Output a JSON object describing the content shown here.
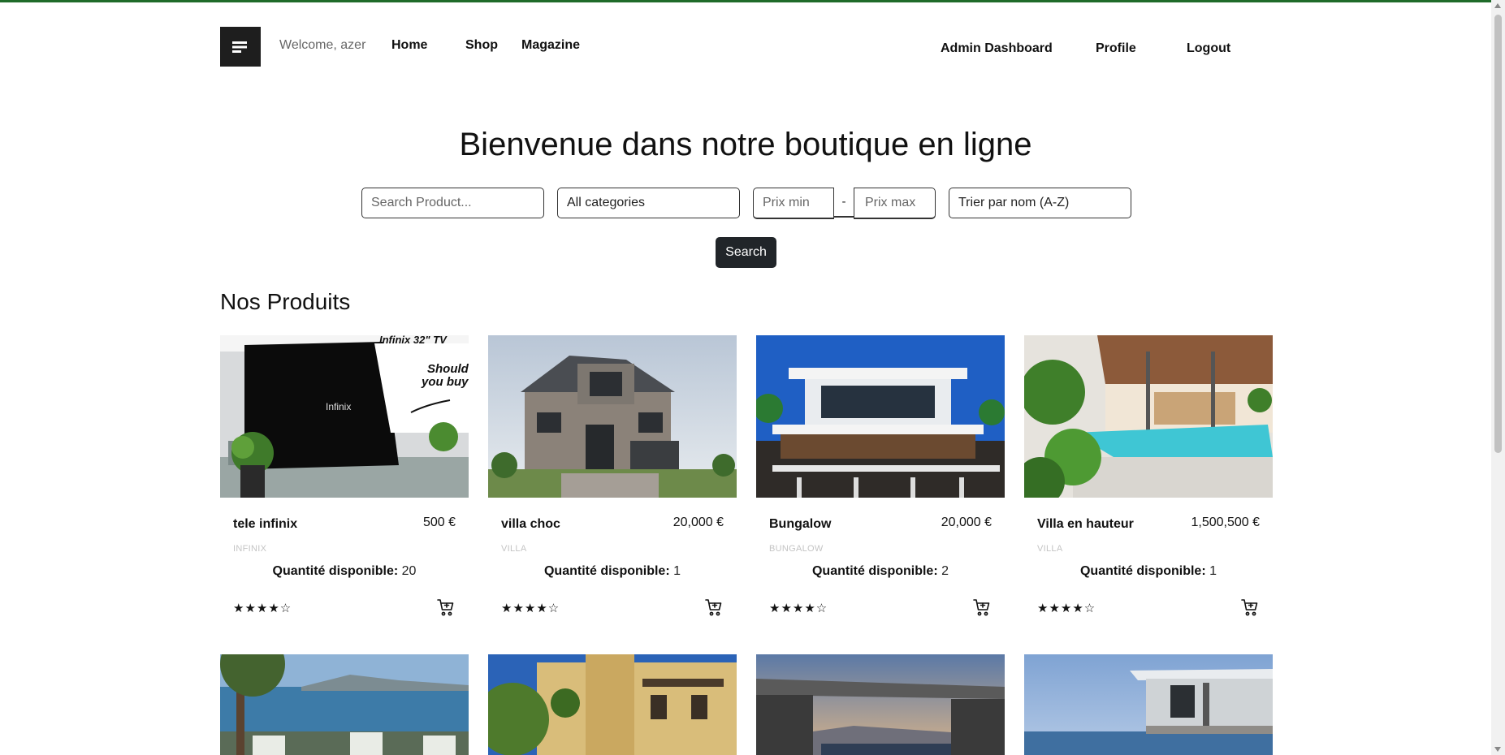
{
  "header": {
    "welcome": "Welcome, azer",
    "nav": {
      "home": "Home",
      "shop": "Shop",
      "magazine": "Magazine"
    },
    "right": {
      "admin": "Admin Dashboard",
      "profile": "Profile",
      "logout": "Logout"
    }
  },
  "hero": {
    "title": "Bienvenue dans notre boutique en ligne",
    "search_placeholder": "Search Product...",
    "category_selected": "All categories",
    "price_min_placeholder": "Prix min",
    "price_separator": "-",
    "price_max_placeholder": "Prix max",
    "sort_selected": "Trier par nom (A-Z)",
    "search_button": "Search"
  },
  "products_section": {
    "title": "Nos Produits",
    "qty_label": "Quantité disponible:",
    "items": [
      {
        "name": "tele infinix",
        "price": "500 €",
        "brand": "INFINIX",
        "qty": "20",
        "stars": "★★★★☆",
        "rating": 4
      },
      {
        "name": "villa choc",
        "price": "20,000 €",
        "brand": "VILLA",
        "qty": "1",
        "stars": "★★★★☆",
        "rating": 4
      },
      {
        "name": "Bungalow",
        "price": "20,000 €",
        "brand": "BUNGALOW",
        "qty": "2",
        "stars": "★★★★☆",
        "rating": 4
      },
      {
        "name": "Villa en hauteur",
        "price": "1,500,500 €",
        "brand": "VILLA",
        "qty": "1",
        "stars": "★★★★☆",
        "rating": 4
      }
    ],
    "tv_image_text": {
      "model": "Infinix 32\" TV",
      "line1": "Should",
      "line2": "you buy",
      "logo": "Infinix"
    }
  },
  "icons": {
    "menu": "menu-icon",
    "cart": "cart-plus-icon",
    "star": "star-icon"
  },
  "colors": {
    "accent_top_line": "#1f6b2a",
    "button_dark": "#212529",
    "menu_bg": "#1e1e1e"
  }
}
